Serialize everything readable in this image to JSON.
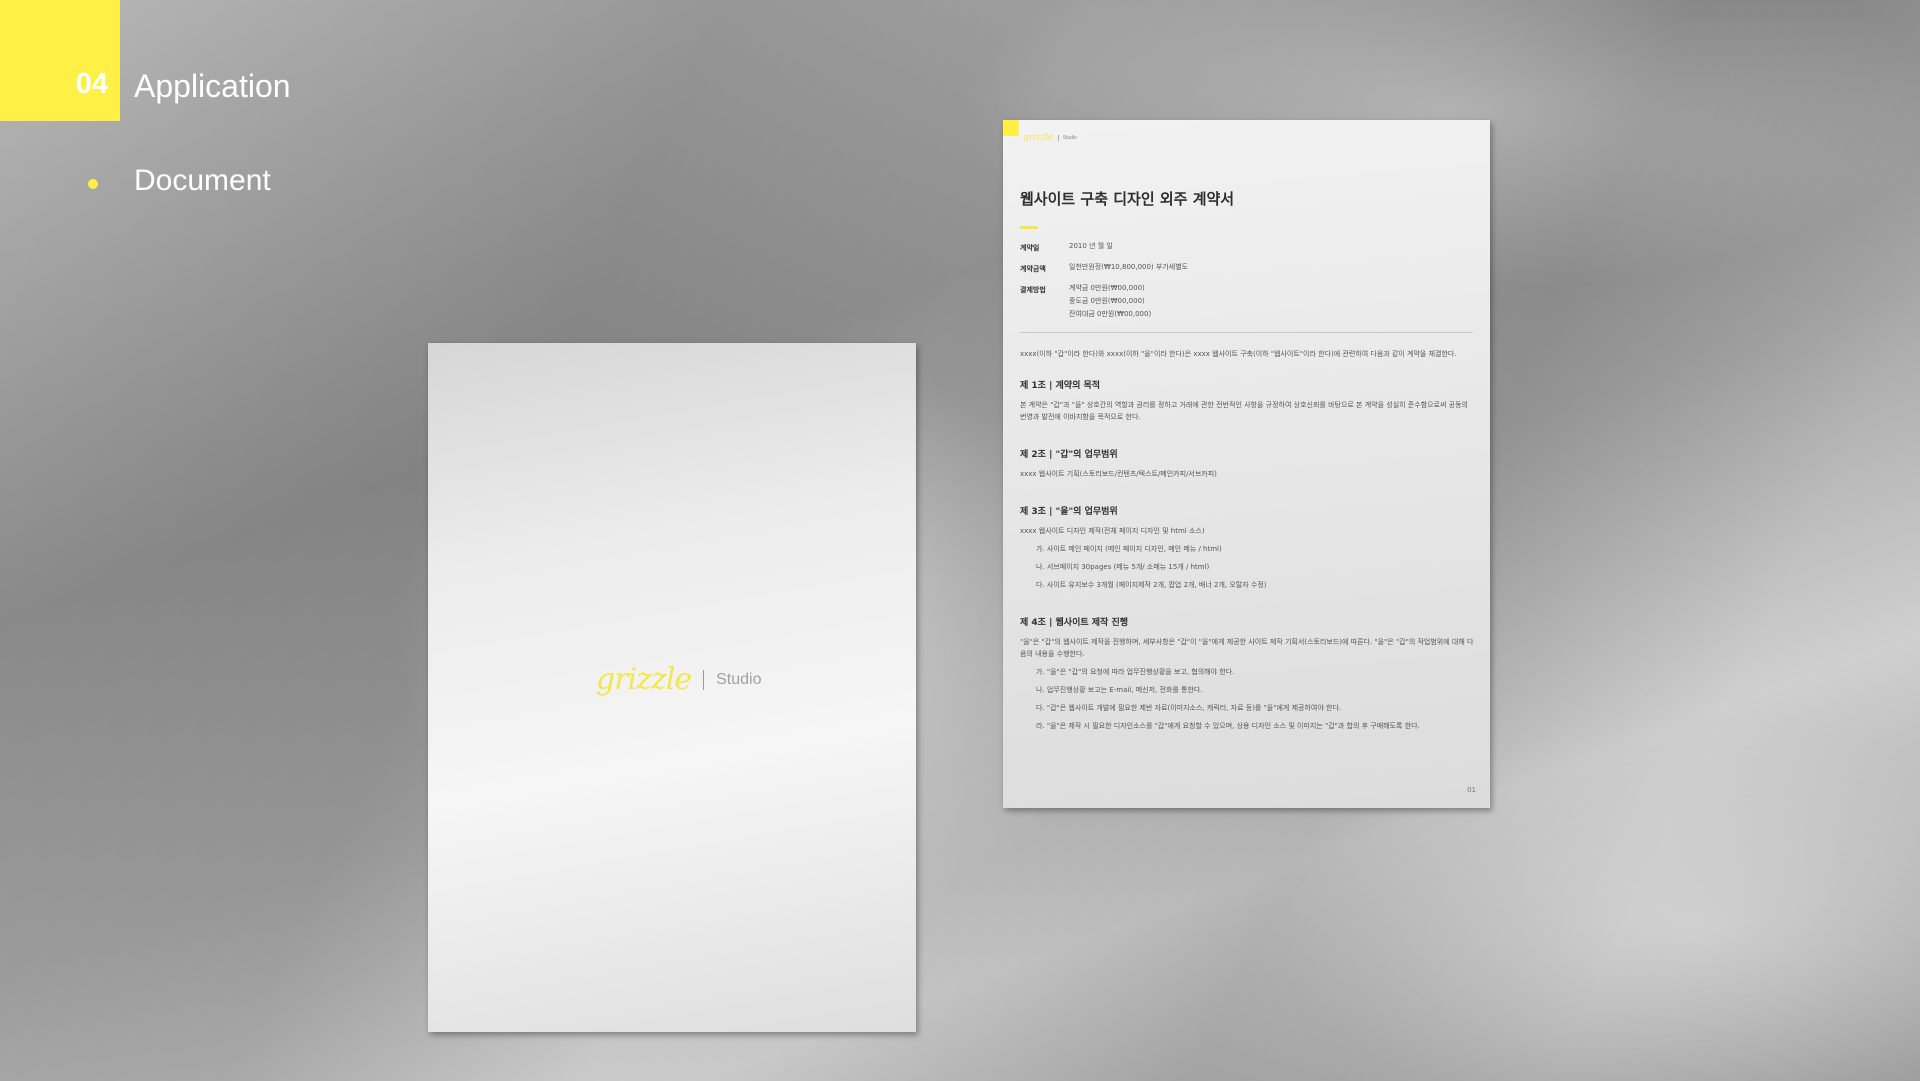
{
  "header": {
    "section_number": "04",
    "section_title": "Application",
    "bullet_label": "Document"
  },
  "cover": {
    "logo_text": "grizzle",
    "logo_suffix": "Studio"
  },
  "contract": {
    "logo_text": "grizzle",
    "logo_suffix": "Studio",
    "title": "웹사이트 구축 디자인 외주 계약서",
    "meta": [
      {
        "label": "계약일",
        "value": "2010 년 월 일"
      },
      {
        "label": "계약금액",
        "value": "일천만원정(₩10,800,000) 부가세별도"
      },
      {
        "label": "결제방법",
        "value": "계약금 0만원(₩00,000)"
      }
    ],
    "payment_extra": [
      "중도금 0만원(₩00,000)",
      "잔여대금 0만원(₩00,000)"
    ],
    "intro": "xxxx(이하 \"갑\"이라 한다)와 xxxx(이하 \"을\"이라 한다)은 xxxx 웹사이트 구축(이하 \"웹사이트\"이라 한다)에 관련하여 다음과 같이 계약을 체결한다.",
    "articles": [
      {
        "title": "제 1조 | 계약의 목적",
        "text": "본 계약은 \"갑\"과 \"을\" 상호간의 역할과 권리를 정하고 거래에 관한 전반적인 사항을 규정하여 상호신뢰를 바탕으로 본 계약을 성실히 준수함으로써 공동의 번영과 발전에 이바지함을 목적으로 한다.",
        "items": []
      },
      {
        "title": "제 2조 | \"갑\"의 업무범위",
        "text": "xxxx 웹사이트 기획(스토리보드/컨텐츠/텍스트/메인카피/서브카피)",
        "items": []
      },
      {
        "title": "제 3조 | \"을\"의 업무범위",
        "text": "xxxx 웹사이트 디자인 제작(전체 페이지 디자인 및 html 소스)",
        "items": [
          "가. 사이트 메인 페이지 (메인 페이지 디자인, 메인 메뉴 / html)",
          "나. 서브페이지 30pages (메뉴 5개/ 소메뉴 15개 / html)",
          "다. 사이트 유지보수 3개월 (페이지제작 2개, 팝업 2개, 배너 2개, 오탈자 수정)"
        ]
      },
      {
        "title": "제 4조 | 웹사이트 제작 진행",
        "text": "\"을\"은 \"갑\"의 웹사이트 제작을 진행하며, 세부사항은 \"갑\"이 \"을\"에게 제공한 사이트 제작 기획서(스토리보드)에 따른다. \"을\"은 \"갑\"의 작업범위에 대해 다음의 내용을 수행한다.",
        "items": [
          "가. \"을\"은 \"갑\"의 요청에 따라 업무진행상황을 보고, 협의해야 한다.",
          "나. 업무진행상황 보고는 E-mail, 메신저, 전화를 통한다.",
          "다. \"갑\"은 웹사이트 개발에 필요한 제반 자료(이미지소스, 캐릭터, 자료 등)를 \"을\"에게 제공하여야 한다.",
          "라. \"을\"은 제작 시 필요한 디자인소스를 \"갑\"에게 요청할 수 있으며, 상용 디자인 소스 및 이미지는 \"갑\"과 합의 후 구매해도록 한다."
        ]
      }
    ],
    "page_number": "01"
  },
  "colors": {
    "accent": "#fff046",
    "text_white": "#ffffff"
  }
}
